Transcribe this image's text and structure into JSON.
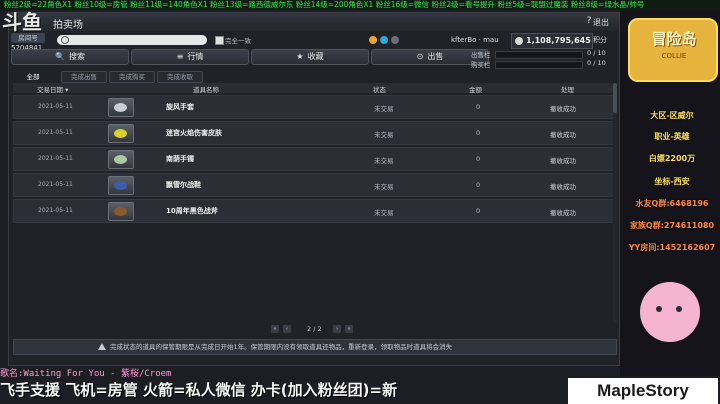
{
  "overlay": {
    "ticker_text": "粉丝2级=22角色X1 粉丝10级=房管 粉丝11级=140角色X1 粉丝13级=路西德威尔东 粉丝14级=200角色X1 粉丝16级=微信    粉丝2级=看号提升 粉丝5级=联盟过魔装 粉丝8级=绿水晶/帅号",
    "logo": "斗鱼",
    "song": "歌名:Waiting For You - 紫桜/Croem",
    "bottom_ticker": "飞手支援  飞机=房管  火箭=私人微信  办卡(加入粉丝团)=新",
    "brand": "MapleStory",
    "stream_info": {
      "region": "大区-区威尔",
      "job": "职业-英雄",
      "power": "白嫖2200万",
      "union": "坐标-西安",
      "water": "水友Q群:6468196",
      "family": "家族Q群:274611080",
      "yy": "YY房间:1452162607"
    },
    "cute_logo": {
      "title": "冒险岛",
      "sub": "COLLIE"
    }
  },
  "window": {
    "title": "拍卖场",
    "help": "?",
    "exit": "退出"
  },
  "search": {
    "charcode_tag": "房间号",
    "charcode": "5204841",
    "placeholder": "",
    "exact_label": "完全一致"
  },
  "tabs": [
    {
      "icon": "🔍",
      "label": "搜索"
    },
    {
      "icon": "≡",
      "label": "行情"
    },
    {
      "icon": "★",
      "label": "收藏"
    },
    {
      "icon": "⊙",
      "label": "出售"
    }
  ],
  "account": {
    "user_id": "kfterBo · mau",
    "mesos": "1,108,795,645",
    "points": "积分"
  },
  "slots": {
    "sell_label": "出售栏",
    "sell_count": "0 / 10",
    "buy_label": "购买栏",
    "buy_count": "0 / 10"
  },
  "filters": [
    {
      "label": "全部",
      "active": true
    },
    {
      "label": "完成出售",
      "active": false
    },
    {
      "label": "完成购买",
      "active": false
    },
    {
      "label": "完成收取",
      "active": false
    }
  ],
  "table": {
    "headers": {
      "date": "交易日期 ▾",
      "name": "道具名称",
      "state": "状态",
      "amount": "金额",
      "process": "处理"
    },
    "rows": [
      {
        "date": "2021-05-11",
        "name": "旋风手套",
        "state": "未交易",
        "amount": "0",
        "process": "撤收成功",
        "color": "#c9ced6"
      },
      {
        "date": "2021-05-11",
        "name": "迷宫火焰伤害皮肤",
        "state": "未交易",
        "amount": "0",
        "process": "撤收成功",
        "color": "#d8d22a"
      },
      {
        "date": "2021-05-11",
        "name": "南荫手镯",
        "state": "未交易",
        "amount": "0",
        "process": "撤收成功",
        "color": "#a9c9a0"
      },
      {
        "date": "2021-05-11",
        "name": "飘雪尔战鞋",
        "state": "未交易",
        "amount": "0",
        "process": "撤收成功",
        "color": "#3a5ea8"
      },
      {
        "date": "2021-05-11",
        "name": "10周年黑色战斧",
        "state": "未交易",
        "amount": "0",
        "process": "撤收成功",
        "color": "#8a5a2a"
      }
    ]
  },
  "pager": {
    "first": "«",
    "prev": "‹",
    "page": "2 / 2",
    "next": "›",
    "last": "»"
  },
  "notice": "完成状态的道具的保管期限是从完成日开始1年。保管期限内没有领取道具还物品，重新登录，领取物品时道具将会消失"
}
